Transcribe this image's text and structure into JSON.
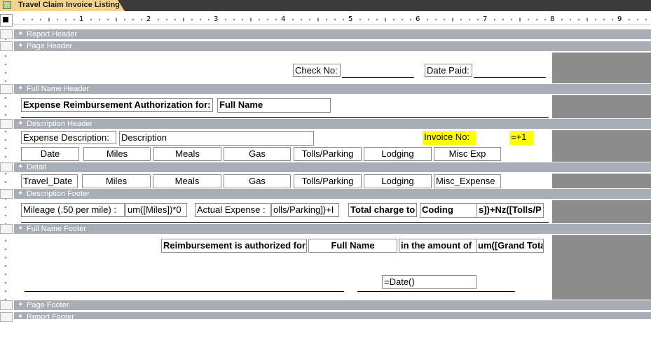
{
  "window": {
    "tab_title": "Travel Claim Invoice Listing"
  },
  "ruler": {
    "numbers": [
      "1",
      "2",
      "3",
      "4",
      "5",
      "6",
      "7",
      "8",
      "9"
    ]
  },
  "bands": {
    "report_header": "Report Header",
    "page_header": "Page Header",
    "full_name_header": "Full Name Header",
    "description_header": "Description Header",
    "detail": "Detail",
    "description_footer": "Description Footer",
    "full_name_footer": "Full Name Footer",
    "page_footer": "Page Footer",
    "report_footer": "Report Footer"
  },
  "page_header": {
    "check_no_label": "Check No:",
    "date_paid_label": "Date Paid:"
  },
  "full_name_header": {
    "auth_label": "Expense Reimbursement Authorization for:",
    "full_name_field": "Full Name"
  },
  "description_header": {
    "expense_desc_label": "Expense Description:",
    "description_field": "Description",
    "invoice_no_label": "Invoice No:",
    "invoice_no_field": "=+1",
    "columns": [
      "Date",
      "Miles",
      "Meals",
      "Gas",
      "Tolls/Parking",
      "Lodging",
      "Misc Exp"
    ]
  },
  "detail": {
    "fields": [
      "Travel_Date",
      "Miles",
      "Meals",
      "Gas",
      "Tolls/Parking",
      "Lodging",
      "Misc_Expense"
    ]
  },
  "description_footer": {
    "mileage_label": "Mileage (.50 per mile) :",
    "mileage_field": "um([Miles])*0",
    "actual_expense_label": "Actual Expense :",
    "actual_expense_field": "olls/Parking])+I",
    "total_charge_label": "Total charge to",
    "coding_field": "Coding",
    "total_field": "s])+Nz([Tolls/P"
  },
  "full_name_footer": {
    "authorized_label": "Reimbursement is authorized for",
    "full_name_field": "Full Name",
    "amount_label": "in the amount of",
    "amount_field": "um([Grand Tota",
    "date_field": "=Date()"
  },
  "colors": {
    "band": "#a9adb6",
    "highlight": "#ffff00",
    "gray_area": "#8c8c8c"
  }
}
